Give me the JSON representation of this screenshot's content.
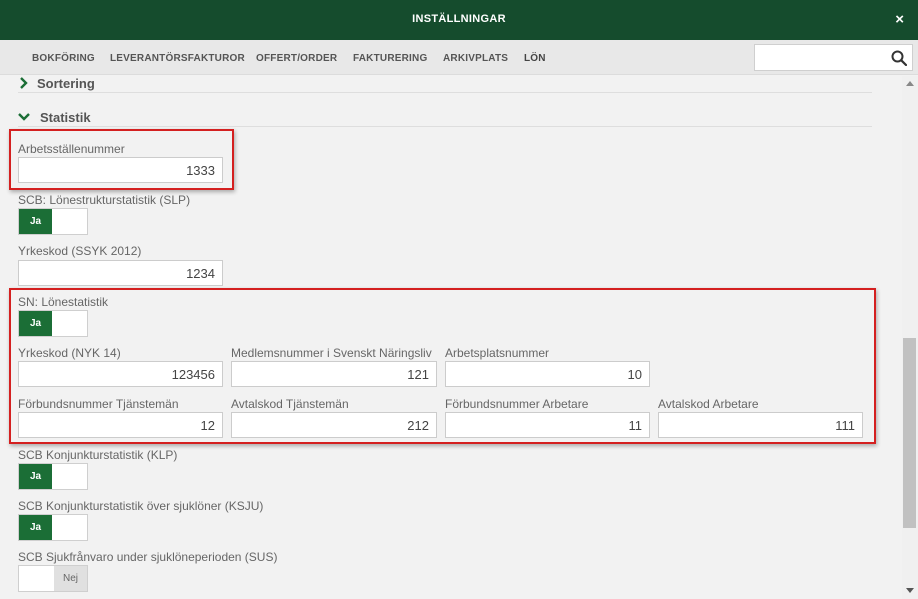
{
  "window": {
    "title": "INSTÄLLNINGAR",
    "close_label": "×"
  },
  "tabs": [
    {
      "label": "BOKFÖRING"
    },
    {
      "label": "LEVERANTÖRSFAKTUROR"
    },
    {
      "label": "OFFERT/ORDER"
    },
    {
      "label": "FAKTURERING"
    },
    {
      "label": "ARKIVPLATS"
    },
    {
      "label": "LÖN",
      "active": true
    }
  ],
  "search": {
    "value": "",
    "placeholder": "",
    "icon": "search-icon"
  },
  "sections": {
    "sortering": {
      "label": "Sortering",
      "icon": "chevron-right-icon"
    },
    "statistik": {
      "label": "Statistik",
      "icon": "chevron-down-icon"
    }
  },
  "fields": {
    "arbetsstallenummer": {
      "label": "Arbetsställenummer",
      "value": "1333"
    },
    "slp": {
      "label": "SCB: Lönestrukturstatistik (SLP)",
      "on_label": "Ja"
    },
    "ssyk": {
      "label": "Yrkeskod (SSYK 2012)",
      "value": "1234"
    },
    "sn": {
      "label": "SN: Lönestatistik",
      "on_label": "Ja"
    },
    "nyk": {
      "label": "Yrkeskod (NYK 14)",
      "value": "123456"
    },
    "medlemsnummer": {
      "label": "Medlemsnummer i Svenskt Näringsliv",
      "value": "121"
    },
    "arbetsplatsnummer": {
      "label": "Arbetsplatsnummer",
      "value": "10"
    },
    "forbund_tjansteman": {
      "label": "Förbundsnummer Tjänstemän",
      "value": "12"
    },
    "avtal_tjansteman": {
      "label": "Avtalskod Tjänstemän",
      "value": "212"
    },
    "forbund_arbetare": {
      "label": "Förbundsnummer Arbetare",
      "value": "11"
    },
    "avtal_arbetare": {
      "label": "Avtalskod Arbetare",
      "value": "111"
    },
    "klp": {
      "label": "SCB Konjunkturstatistik (KLP)",
      "on_label": "Ja"
    },
    "ksju": {
      "label": "SCB Konjunkturstatistik över sjuklöner (KSJU)",
      "on_label": "Ja"
    },
    "sus": {
      "label": "SCB Sjukfrånvaro under sjuklöneperioden (SUS)",
      "off_label": "Nej"
    }
  },
  "colors": {
    "header": "#154c2d",
    "toggle_on": "#1b6e36",
    "highlight": "#d42020"
  }
}
